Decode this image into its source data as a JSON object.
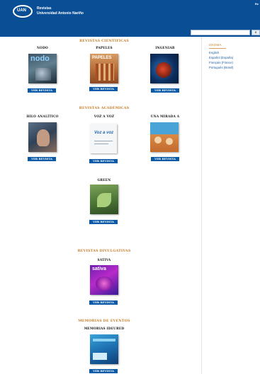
{
  "header": {
    "logo_text": "UAN",
    "title_line1": "Revistas",
    "title_line2": "Universidad Antonio Nariño",
    "corner_text": "Re",
    "search_placeholder": "",
    "search_button": "B"
  },
  "sidebar": {
    "title": "IDIOMA",
    "languages": [
      "English",
      "Español (España)",
      "Français (France)",
      "Português (Brasil)"
    ]
  },
  "sections": [
    {
      "title": "REVISTAS CIENTÍFICAS"
    },
    {
      "title": "REVISTAS ACADÉMICAS"
    },
    {
      "title": "REVISTAS DIVULGATIVAS"
    },
    {
      "title": "MEMORIAS DE EVENTOS"
    }
  ],
  "journals": [
    {
      "name": "NODO",
      "cover_text": "nodo",
      "button": "VER REVISTA"
    },
    {
      "name": "PAPELES",
      "cover_text": "PAPELES",
      "button": "VER REVISTA"
    },
    {
      "name": "INGENIAR",
      "cover_text": "",
      "button": "VER REVISTA"
    },
    {
      "name": "HILO ANALÍTICO",
      "cover_text": "",
      "button": "VER REVISTA"
    },
    {
      "name": "VOZ A VOZ",
      "cover_text": "Voz a voz",
      "button": "VER REVISTA"
    },
    {
      "name": "UNA MIRADA A",
      "cover_text": "",
      "button": "VER REVISTA"
    },
    {
      "name": "GREEN",
      "cover_text": "",
      "button": "VER REVISTA"
    },
    {
      "name": "SATIVA",
      "cover_text": "sativa",
      "button": "VER REVISTA"
    },
    {
      "name": "MEMORIAS IDEURED",
      "cover_text": "",
      "button": "VER REVISTA"
    }
  ],
  "colors": {
    "header_blue": "#0a4f95",
    "section_orange": "#c77c28",
    "button_blue": "#0a5aa8"
  }
}
